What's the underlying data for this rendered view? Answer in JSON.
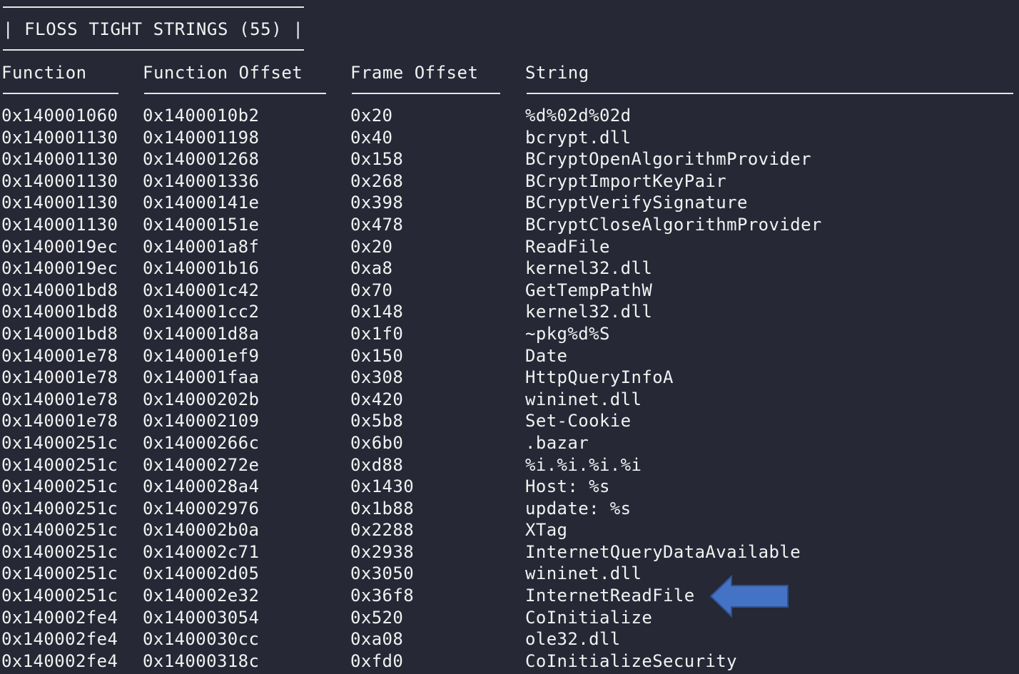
{
  "title": "| FLOSS TIGHT STRINGS (55) |",
  "headers": {
    "function": "Function",
    "function_offset": "Function Offset",
    "frame_offset": "Frame Offset",
    "string": "String"
  },
  "rows": [
    {
      "function": "0x140001060",
      "function_offset": "0x1400010b2",
      "frame_offset": "0x20",
      "string": "%d%02d%02d"
    },
    {
      "function": "0x140001130",
      "function_offset": "0x140001198",
      "frame_offset": "0x40",
      "string": "bcrypt.dll"
    },
    {
      "function": "0x140001130",
      "function_offset": "0x140001268",
      "frame_offset": "0x158",
      "string": "BCryptOpenAlgorithmProvider"
    },
    {
      "function": "0x140001130",
      "function_offset": "0x140001336",
      "frame_offset": "0x268",
      "string": "BCryptImportKeyPair"
    },
    {
      "function": "0x140001130",
      "function_offset": "0x14000141e",
      "frame_offset": "0x398",
      "string": "BCryptVerifySignature"
    },
    {
      "function": "0x140001130",
      "function_offset": "0x14000151e",
      "frame_offset": "0x478",
      "string": "BCryptCloseAlgorithmProvider"
    },
    {
      "function": "0x1400019ec",
      "function_offset": "0x140001a8f",
      "frame_offset": "0x20",
      "string": "ReadFile"
    },
    {
      "function": "0x1400019ec",
      "function_offset": "0x140001b16",
      "frame_offset": "0xa8",
      "string": "kernel32.dll"
    },
    {
      "function": "0x140001bd8",
      "function_offset": "0x140001c42",
      "frame_offset": "0x70",
      "string": "GetTempPathW"
    },
    {
      "function": "0x140001bd8",
      "function_offset": "0x140001cc2",
      "frame_offset": "0x148",
      "string": "kernel32.dll"
    },
    {
      "function": "0x140001bd8",
      "function_offset": "0x140001d8a",
      "frame_offset": "0x1f0",
      "string": "~pkg%d%S"
    },
    {
      "function": "0x140001e78",
      "function_offset": "0x140001ef9",
      "frame_offset": "0x150",
      "string": "Date"
    },
    {
      "function": "0x140001e78",
      "function_offset": "0x140001faa",
      "frame_offset": "0x308",
      "string": "HttpQueryInfoA"
    },
    {
      "function": "0x140001e78",
      "function_offset": "0x14000202b",
      "frame_offset": "0x420",
      "string": "wininet.dll"
    },
    {
      "function": "0x140001e78",
      "function_offset": "0x140002109",
      "frame_offset": "0x5b8",
      "string": "Set-Cookie"
    },
    {
      "function": "0x14000251c",
      "function_offset": "0x14000266c",
      "frame_offset": "0x6b0",
      "string": ".bazar"
    },
    {
      "function": "0x14000251c",
      "function_offset": "0x14000272e",
      "frame_offset": "0xd88",
      "string": "%i.%i.%i.%i"
    },
    {
      "function": "0x14000251c",
      "function_offset": "0x1400028a4",
      "frame_offset": "0x1430",
      "string": "Host: %s"
    },
    {
      "function": "0x14000251c",
      "function_offset": "0x140002976",
      "frame_offset": "0x1b88",
      "string": "update: %s"
    },
    {
      "function": "0x14000251c",
      "function_offset": "0x140002b0a",
      "frame_offset": "0x2288",
      "string": "XTag"
    },
    {
      "function": "0x14000251c",
      "function_offset": "0x140002c71",
      "frame_offset": "0x2938",
      "string": "InternetQueryDataAvailable"
    },
    {
      "function": "0x14000251c",
      "function_offset": "0x140002d05",
      "frame_offset": "0x3050",
      "string": "wininet.dll"
    },
    {
      "function": "0x14000251c",
      "function_offset": "0x140002e32",
      "frame_offset": "0x36f8",
      "string": "InternetReadFile"
    },
    {
      "function": "0x140002fe4",
      "function_offset": "0x140003054",
      "frame_offset": "0x520",
      "string": "CoInitialize"
    },
    {
      "function": "0x140002fe4",
      "function_offset": "0x1400030cc",
      "frame_offset": "0xa08",
      "string": "ole32.dll"
    },
    {
      "function": "0x140002fe4",
      "function_offset": "0x14000318c",
      "frame_offset": "0xfd0",
      "string": "CoInitializeSecurity"
    }
  ],
  "colors": {
    "background": "#262835",
    "text": "#f2f2f2",
    "arrow_fill": "#4472c4",
    "arrow_stroke": "#2f528f"
  },
  "annotation_icon": "left-arrow-icon"
}
